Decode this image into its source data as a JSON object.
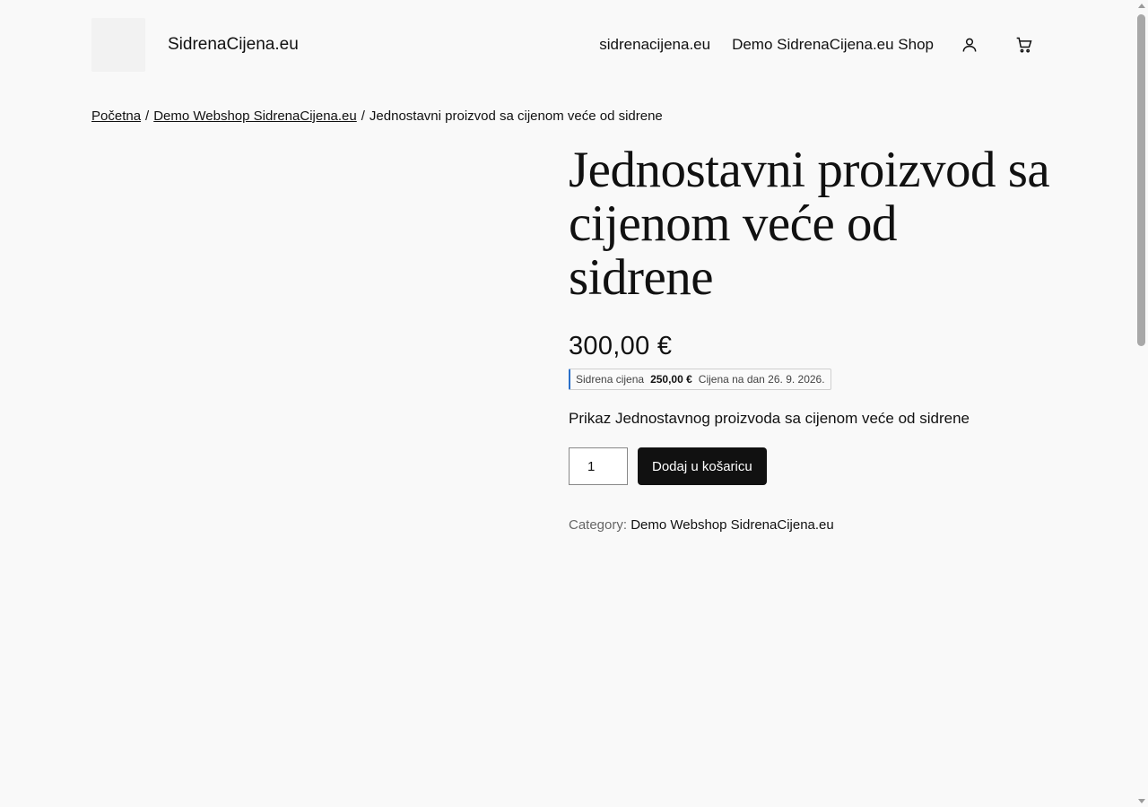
{
  "header": {
    "site_title": "SidrenaCijena.eu",
    "nav": [
      {
        "label": "sidrenacijena.eu"
      },
      {
        "label": "Demo SidrenaCijena.eu Shop"
      }
    ],
    "icons": [
      "account-icon",
      "cart-icon"
    ]
  },
  "breadcrumb": {
    "home": "Početna",
    "category": "Demo Webshop SidrenaCijena.eu",
    "current": "Jednostavni proizvod sa cijenom veće od sidrene",
    "separator": "/"
  },
  "product": {
    "title": "Jednostavni proizvod sa cijenom veće od sidrene",
    "price": "300,00 €",
    "anchor": {
      "label": "Sidrena cijena",
      "price": "250,00 €",
      "date_text": "Cijena na dan 26. 9. 2026."
    },
    "description": "Prikaz Jednostavnog proizvoda sa cijenom veće od sidrene",
    "quantity": "1",
    "add_to_cart_label": "Dodaj u košaricu",
    "meta": {
      "category_label": "Category:",
      "category_value": "Demo Webshop SidrenaCijena.eu"
    }
  }
}
